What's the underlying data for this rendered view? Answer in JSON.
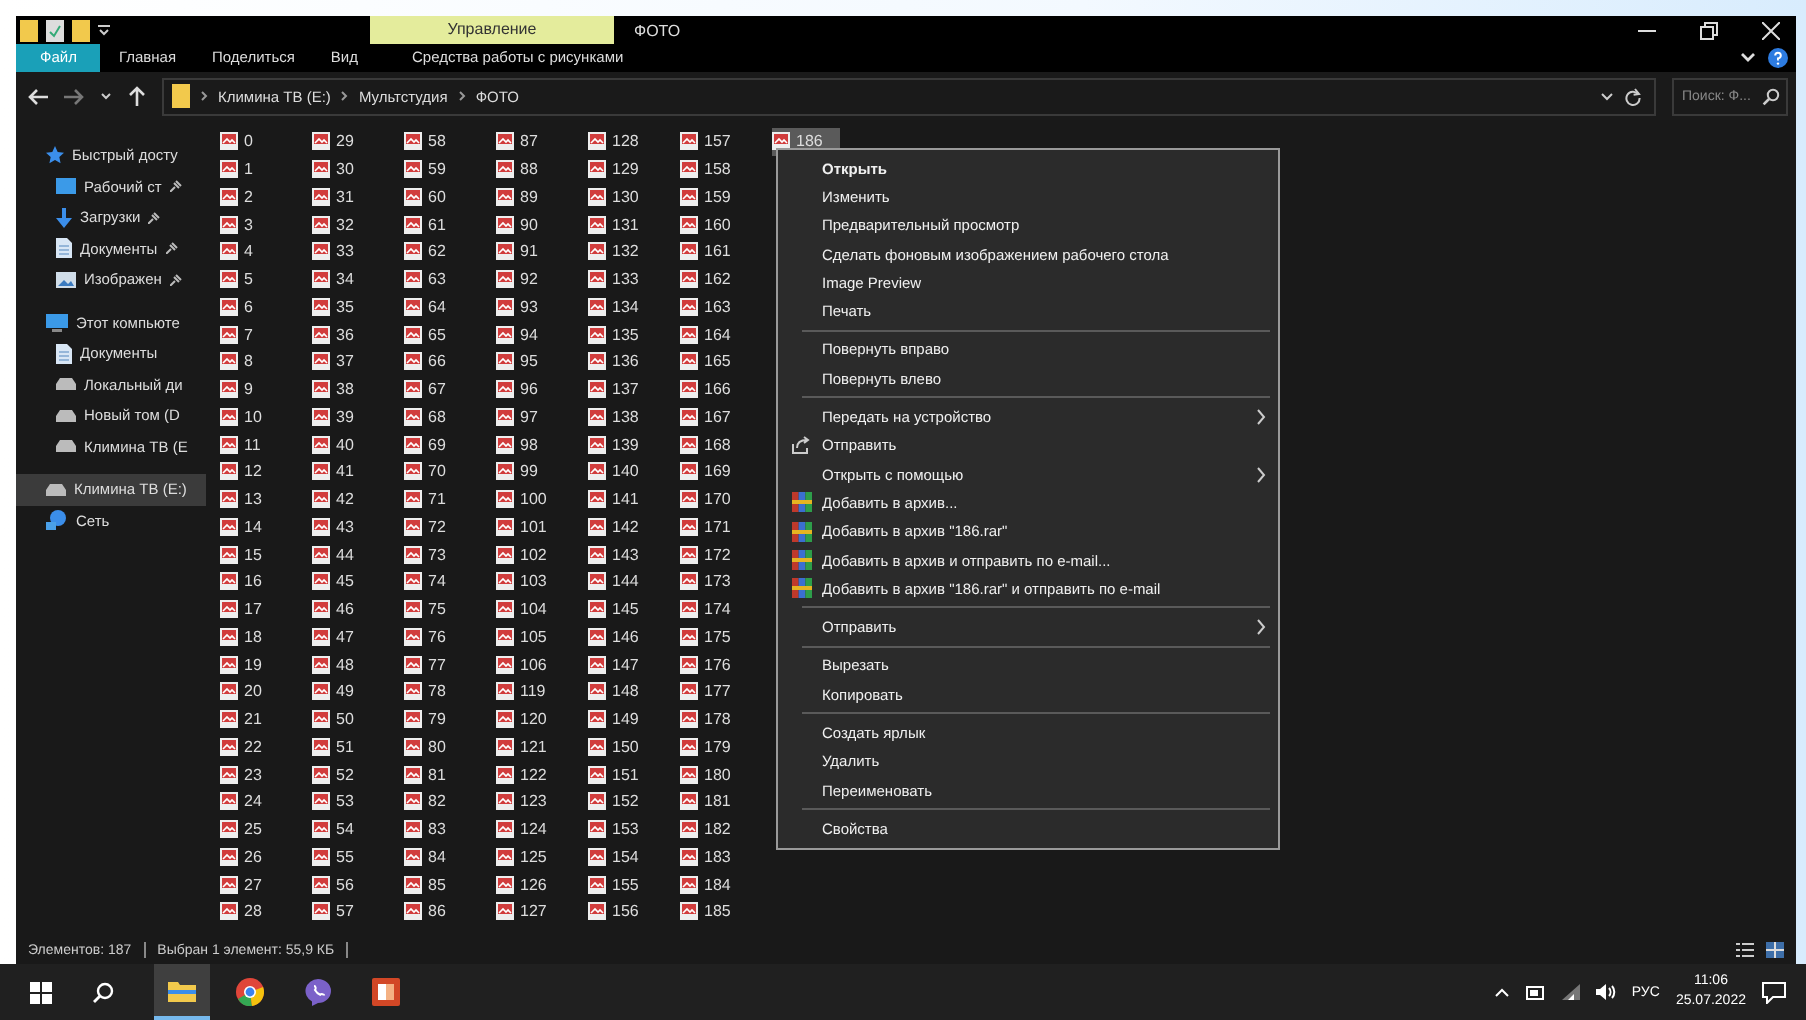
{
  "title_bar": {
    "context_tab": "Управление",
    "title": "ФОТО"
  },
  "ribbon_tabs": [
    {
      "label": "Файл",
      "kind": "file"
    },
    {
      "label": "Главная",
      "kind": "tab"
    },
    {
      "label": "Поделиться",
      "kind": "tab"
    },
    {
      "label": "Вид",
      "kind": "tab"
    },
    {
      "label": "Средства работы с рисунками",
      "kind": "context"
    }
  ],
  "address": {
    "crumbs": [
      "Климина ТВ (E:)",
      "Мультстудия",
      "ФОТО"
    ]
  },
  "search": {
    "placeholder": "Поиск: Ф..."
  },
  "sidebar": {
    "items": [
      {
        "label": "Быстрый досту",
        "kind": "star",
        "selected": false,
        "children": [
          {
            "label": "Рабочий ст",
            "kind": "desktop",
            "pinned": true,
            "selected": false
          },
          {
            "label": "Загрузки",
            "kind": "download",
            "pinned": true,
            "selected": false
          },
          {
            "label": "Документы",
            "kind": "document",
            "pinned": true,
            "selected": false
          },
          {
            "label": "Изображен",
            "kind": "image",
            "pinned": true,
            "selected": false
          }
        ]
      },
      {
        "label": "Этот компьюте",
        "kind": "computer",
        "selected": false,
        "children": [
          {
            "label": "Документы",
            "kind": "document",
            "selected": false
          },
          {
            "label": "Локальный ди",
            "kind": "drive",
            "selected": false
          },
          {
            "label": "Новый том (D",
            "kind": "drive",
            "selected": false
          },
          {
            "label": "Климина ТВ (E",
            "kind": "drive",
            "selected": false
          }
        ]
      },
      {
        "label": "Климина ТВ (E:)",
        "kind": "drive",
        "selected": true
      },
      {
        "label": "Сеть",
        "kind": "network",
        "selected": false
      }
    ]
  },
  "file_columns": [
    [
      {
        "name": "0",
        "selected": false
      },
      {
        "name": "1",
        "selected": false
      },
      {
        "name": "2",
        "selected": false
      },
      {
        "name": "3",
        "selected": false
      },
      {
        "name": "4",
        "selected": false
      },
      {
        "name": "5",
        "selected": false
      },
      {
        "name": "6",
        "selected": false
      },
      {
        "name": "7",
        "selected": false
      },
      {
        "name": "8",
        "selected": false
      },
      {
        "name": "9",
        "selected": false
      },
      {
        "name": "10",
        "selected": false
      },
      {
        "name": "11",
        "selected": false
      },
      {
        "name": "12",
        "selected": false
      },
      {
        "name": "13",
        "selected": false
      },
      {
        "name": "14",
        "selected": false
      },
      {
        "name": "15",
        "selected": false
      },
      {
        "name": "16",
        "selected": false
      },
      {
        "name": "17",
        "selected": false
      },
      {
        "name": "18",
        "selected": false
      },
      {
        "name": "19",
        "selected": false
      },
      {
        "name": "20",
        "selected": false
      },
      {
        "name": "21",
        "selected": false
      },
      {
        "name": "22",
        "selected": false
      },
      {
        "name": "23",
        "selected": false
      },
      {
        "name": "24",
        "selected": false
      },
      {
        "name": "25",
        "selected": false
      },
      {
        "name": "26",
        "selected": false
      },
      {
        "name": "27",
        "selected": false
      },
      {
        "name": "28",
        "selected": false
      }
    ],
    [
      {
        "name": "29",
        "selected": false
      },
      {
        "name": "30",
        "selected": false
      },
      {
        "name": "31",
        "selected": false
      },
      {
        "name": "32",
        "selected": false
      },
      {
        "name": "33",
        "selected": false
      },
      {
        "name": "34",
        "selected": false
      },
      {
        "name": "35",
        "selected": false
      },
      {
        "name": "36",
        "selected": false
      },
      {
        "name": "37",
        "selected": false
      },
      {
        "name": "38",
        "selected": false
      },
      {
        "name": "39",
        "selected": false
      },
      {
        "name": "40",
        "selected": false
      },
      {
        "name": "41",
        "selected": false
      },
      {
        "name": "42",
        "selected": false
      },
      {
        "name": "43",
        "selected": false
      },
      {
        "name": "44",
        "selected": false
      },
      {
        "name": "45",
        "selected": false
      },
      {
        "name": "46",
        "selected": false
      },
      {
        "name": "47",
        "selected": false
      },
      {
        "name": "48",
        "selected": false
      },
      {
        "name": "49",
        "selected": false
      },
      {
        "name": "50",
        "selected": false
      },
      {
        "name": "51",
        "selected": false
      },
      {
        "name": "52",
        "selected": false
      },
      {
        "name": "53",
        "selected": false
      },
      {
        "name": "54",
        "selected": false
      },
      {
        "name": "55",
        "selected": false
      },
      {
        "name": "56",
        "selected": false
      },
      {
        "name": "57",
        "selected": false
      }
    ],
    [
      {
        "name": "58",
        "selected": false
      },
      {
        "name": "59",
        "selected": false
      },
      {
        "name": "60",
        "selected": false
      },
      {
        "name": "61",
        "selected": false
      },
      {
        "name": "62",
        "selected": false
      },
      {
        "name": "63",
        "selected": false
      },
      {
        "name": "64",
        "selected": false
      },
      {
        "name": "65",
        "selected": false
      },
      {
        "name": "66",
        "selected": false
      },
      {
        "name": "67",
        "selected": false
      },
      {
        "name": "68",
        "selected": false
      },
      {
        "name": "69",
        "selected": false
      },
      {
        "name": "70",
        "selected": false
      },
      {
        "name": "71",
        "selected": false
      },
      {
        "name": "72",
        "selected": false
      },
      {
        "name": "73",
        "selected": false
      },
      {
        "name": "74",
        "selected": false
      },
      {
        "name": "75",
        "selected": false
      },
      {
        "name": "76",
        "selected": false
      },
      {
        "name": "77",
        "selected": false
      },
      {
        "name": "78",
        "selected": false
      },
      {
        "name": "79",
        "selected": false
      },
      {
        "name": "80",
        "selected": false
      },
      {
        "name": "81",
        "selected": false
      },
      {
        "name": "82",
        "selected": false
      },
      {
        "name": "83",
        "selected": false
      },
      {
        "name": "84",
        "selected": false
      },
      {
        "name": "85",
        "selected": false
      },
      {
        "name": "86",
        "selected": false
      }
    ],
    [
      {
        "name": "87",
        "selected": false
      },
      {
        "name": "88",
        "selected": false
      },
      {
        "name": "89",
        "selected": false
      },
      {
        "name": "90",
        "selected": false
      },
      {
        "name": "91",
        "selected": false
      },
      {
        "name": "92",
        "selected": false
      },
      {
        "name": "93",
        "selected": false
      },
      {
        "name": "94",
        "selected": false
      },
      {
        "name": "95",
        "selected": false
      },
      {
        "name": "96",
        "selected": false
      },
      {
        "name": "97",
        "selected": false
      },
      {
        "name": "98",
        "selected": false
      },
      {
        "name": "99",
        "selected": false
      },
      {
        "name": "100",
        "selected": false
      },
      {
        "name": "101",
        "selected": false
      },
      {
        "name": "102",
        "selected": false
      },
      {
        "name": "103",
        "selected": false
      },
      {
        "name": "104",
        "selected": false
      },
      {
        "name": "105",
        "selected": false
      },
      {
        "name": "106",
        "selected": false
      },
      {
        "name": "119",
        "selected": false
      },
      {
        "name": "120",
        "selected": false
      },
      {
        "name": "121",
        "selected": false
      },
      {
        "name": "122",
        "selected": false
      },
      {
        "name": "123",
        "selected": false
      },
      {
        "name": "124",
        "selected": false
      },
      {
        "name": "125",
        "selected": false
      },
      {
        "name": "126",
        "selected": false
      },
      {
        "name": "127",
        "selected": false
      }
    ],
    [
      {
        "name": "128",
        "selected": false
      },
      {
        "name": "129",
        "selected": false
      },
      {
        "name": "130",
        "selected": false
      },
      {
        "name": "131",
        "selected": false
      },
      {
        "name": "132",
        "selected": false
      },
      {
        "name": "133",
        "selected": false
      },
      {
        "name": "134",
        "selected": false
      },
      {
        "name": "135",
        "selected": false
      },
      {
        "name": "136",
        "selected": false
      },
      {
        "name": "137",
        "selected": false
      },
      {
        "name": "138",
        "selected": false
      },
      {
        "name": "139",
        "selected": false
      },
      {
        "name": "140",
        "selected": false
      },
      {
        "name": "141",
        "selected": false
      },
      {
        "name": "142",
        "selected": false
      },
      {
        "name": "143",
        "selected": false
      },
      {
        "name": "144",
        "selected": false
      },
      {
        "name": "145",
        "selected": false
      },
      {
        "name": "146",
        "selected": false
      },
      {
        "name": "147",
        "selected": false
      },
      {
        "name": "148",
        "selected": false
      },
      {
        "name": "149",
        "selected": false
      },
      {
        "name": "150",
        "selected": false
      },
      {
        "name": "151",
        "selected": false
      },
      {
        "name": "152",
        "selected": false
      },
      {
        "name": "153",
        "selected": false
      },
      {
        "name": "154",
        "selected": false
      },
      {
        "name": "155",
        "selected": false
      },
      {
        "name": "156",
        "selected": false
      }
    ],
    [
      {
        "name": "157",
        "selected": false
      },
      {
        "name": "158",
        "selected": false
      },
      {
        "name": "159",
        "selected": false
      },
      {
        "name": "160",
        "selected": false
      },
      {
        "name": "161",
        "selected": false
      },
      {
        "name": "162",
        "selected": false
      },
      {
        "name": "163",
        "selected": false
      },
      {
        "name": "164",
        "selected": false
      },
      {
        "name": "165",
        "selected": false
      },
      {
        "name": "166",
        "selected": false
      },
      {
        "name": "167",
        "selected": false
      },
      {
        "name": "168",
        "selected": false
      },
      {
        "name": "169",
        "selected": false
      },
      {
        "name": "170",
        "selected": false
      },
      {
        "name": "171",
        "selected": false
      },
      {
        "name": "172",
        "selected": false
      },
      {
        "name": "173",
        "selected": false
      },
      {
        "name": "174",
        "selected": false
      },
      {
        "name": "175",
        "selected": false
      },
      {
        "name": "176",
        "selected": false
      },
      {
        "name": "177",
        "selected": false
      },
      {
        "name": "178",
        "selected": false
      },
      {
        "name": "179",
        "selected": false
      },
      {
        "name": "180",
        "selected": false
      },
      {
        "name": "181",
        "selected": false
      },
      {
        "name": "182",
        "selected": false
      },
      {
        "name": "183",
        "selected": false
      },
      {
        "name": "184",
        "selected": false
      },
      {
        "name": "185",
        "selected": false
      }
    ],
    [
      {
        "name": "186",
        "selected": true
      }
    ]
  ],
  "context_menu": [
    {
      "kind": "item",
      "label": "Открыть",
      "default": true,
      "submenu": false
    },
    {
      "kind": "item",
      "label": "Изменить",
      "default": false,
      "submenu": false
    },
    {
      "kind": "item",
      "label": "Предварительный просмотр",
      "default": false,
      "submenu": false
    },
    {
      "kind": "item",
      "label": "Сделать фоновым изображением рабочего стола",
      "default": false,
      "submenu": false
    },
    {
      "kind": "item",
      "label": "Image Preview",
      "default": false,
      "submenu": false
    },
    {
      "kind": "item",
      "label": "Печать",
      "default": false,
      "submenu": false
    },
    {
      "kind": "separator"
    },
    {
      "kind": "item",
      "label": "Повернуть вправо",
      "default": false,
      "submenu": false
    },
    {
      "kind": "item",
      "label": "Повернуть влево",
      "default": false,
      "submenu": false
    },
    {
      "kind": "separator"
    },
    {
      "kind": "item",
      "label": "Передать на устройство",
      "default": false,
      "submenu": true
    },
    {
      "kind": "share",
      "label": "Отправить",
      "default": false,
      "submenu": false
    },
    {
      "kind": "item",
      "label": "Открыть с помощью",
      "default": false,
      "submenu": true
    },
    {
      "kind": "archive",
      "label": "Добавить в архив...",
      "default": false,
      "submenu": false
    },
    {
      "kind": "archive",
      "label": "Добавить в архив \"186.rar\"",
      "default": false,
      "submenu": false
    },
    {
      "kind": "archive",
      "label": "Добавить в архив и отправить по e-mail...",
      "default": false,
      "submenu": false
    },
    {
      "kind": "archive",
      "label": "Добавить в архив \"186.rar\" и отправить по e-mail",
      "default": false,
      "submenu": false
    },
    {
      "kind": "separator"
    },
    {
      "kind": "item",
      "label": "Отправить",
      "default": false,
      "submenu": true
    },
    {
      "kind": "separator"
    },
    {
      "kind": "item",
      "label": "Вырезать",
      "default": false,
      "submenu": false
    },
    {
      "kind": "item",
      "label": "Копировать",
      "default": false,
      "submenu": false
    },
    {
      "kind": "separator"
    },
    {
      "kind": "item",
      "label": "Создать ярлык",
      "default": false,
      "submenu": false
    },
    {
      "kind": "item",
      "label": "Удалить",
      "default": false,
      "submenu": false
    },
    {
      "kind": "item",
      "label": "Переименовать",
      "default": false,
      "submenu": false
    },
    {
      "kind": "separator"
    },
    {
      "kind": "item",
      "label": "Свойства",
      "default": false,
      "submenu": false
    }
  ],
  "status_bar": {
    "count": "Элементов: 187",
    "selection": "Выбран 1 элемент: 55,9 КБ"
  },
  "taskbar": {
    "apps": [
      {
        "kind": "explorer",
        "active": true
      },
      {
        "kind": "browser",
        "active": false
      },
      {
        "kind": "messenger",
        "active": false
      },
      {
        "kind": "slides",
        "active": false
      }
    ],
    "language": "РУС",
    "time": "11:06",
    "date": "25.07.2022"
  }
}
